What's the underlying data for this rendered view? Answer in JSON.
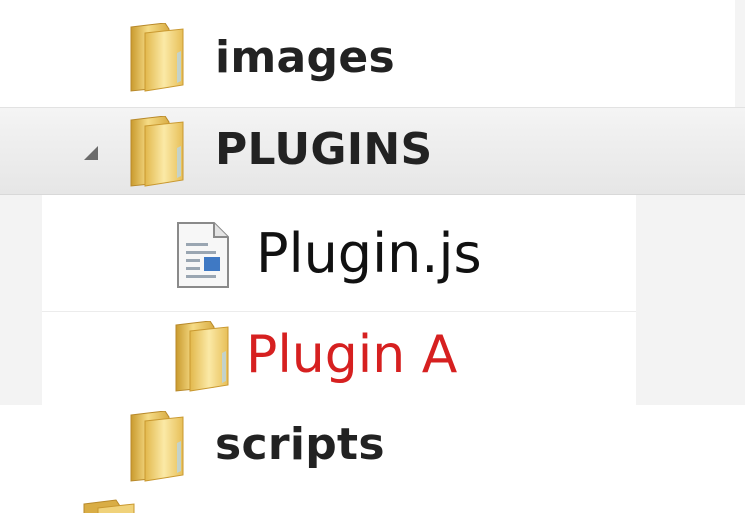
{
  "tree": {
    "items": [
      {
        "label": "images",
        "icon": "folder-icon",
        "expanded": false
      },
      {
        "label": "PLUGINS",
        "icon": "folder-icon",
        "expanded": true,
        "expander": "expanded-triangle-icon"
      },
      {
        "label": "Plugin.js",
        "icon": "js-file-icon"
      },
      {
        "label": "Plugin A",
        "icon": "folder-icon",
        "color": "#d62020"
      },
      {
        "label": "scripts",
        "icon": "folder-icon"
      }
    ]
  },
  "colors": {
    "folder": "#e8c35a",
    "highlight_text": "#d62020",
    "selected_row": "#e9e9e9"
  }
}
